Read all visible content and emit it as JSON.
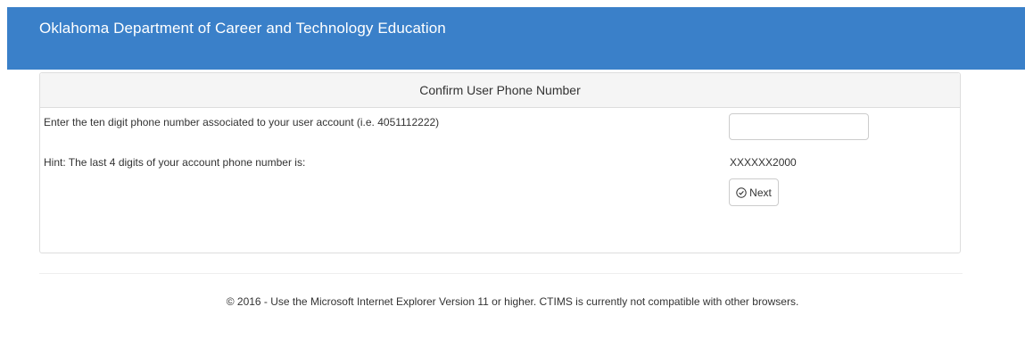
{
  "header": {
    "title": "Oklahoma Department of Career and Technology Education"
  },
  "panel": {
    "heading": "Confirm User Phone Number",
    "phone_label": "Enter the ten digit phone number associated to your user account (i.e. 4051112222)",
    "phone_value": "",
    "phone_placeholder": "",
    "hint_label": "Hint: The last 4 digits of your account phone number is:",
    "hint_value": "XXXXXX2000",
    "next_label": "Next",
    "next_icon": "check-circle-icon"
  },
  "footer": {
    "text": "© 2016 - Use the Microsoft Internet Explorer Version 11 or higher. CTIMS is currently not compatible with other browsers."
  },
  "colors": {
    "header_bg": "#3a80c9",
    "panel_heading_bg": "#f5f5f5",
    "border": "#dddddd"
  }
}
